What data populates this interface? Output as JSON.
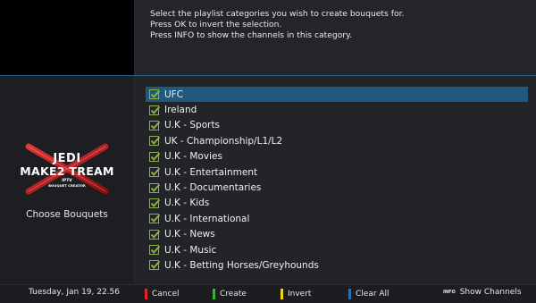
{
  "instructions": [
    "Select the playlist categories you wish to create bouquets for.",
    "Press OK to invert the selection.",
    "Press INFO to show the channels in this category."
  ],
  "logo": {
    "line1": "JEDI",
    "line2": "MAKE2  TREAM",
    "line3": "IPTV",
    "line4": "BOUQUET CREATOR"
  },
  "left_label": "Choose Bouquets",
  "categories": [
    {
      "label": "UFC",
      "checked": true,
      "selected": true
    },
    {
      "label": "Ireland",
      "checked": true
    },
    {
      "label": "U.K - Sports",
      "checked": true
    },
    {
      "label": "UK - Championship/L1/L2",
      "checked": true
    },
    {
      "label": "U.K - Movies",
      "checked": true
    },
    {
      "label": "U.K - Entertainment",
      "checked": true
    },
    {
      "label": "U.K - Documentaries",
      "checked": true
    },
    {
      "label": "U.K - Kids",
      "checked": true
    },
    {
      "label": "U.K - International",
      "checked": true
    },
    {
      "label": "U.K - News",
      "checked": true
    },
    {
      "label": "U.K - Music",
      "checked": true
    },
    {
      "label": "U.K - Betting Horses/Greyhounds",
      "checked": true
    }
  ],
  "footer": {
    "datetime": "Tuesday, Jan 19, 22.56",
    "red": "Cancel",
    "green": "Create",
    "yellow": "Invert",
    "blue": "Clear All",
    "info_icon": "INFO",
    "info": "Show Channels"
  },
  "colors": {
    "red": "#e0242a",
    "green": "#3fae3a",
    "yellow": "#e9d51c",
    "blue": "#2b6fb8",
    "selection": "#1f5a7c",
    "check": "#8ab33f"
  }
}
